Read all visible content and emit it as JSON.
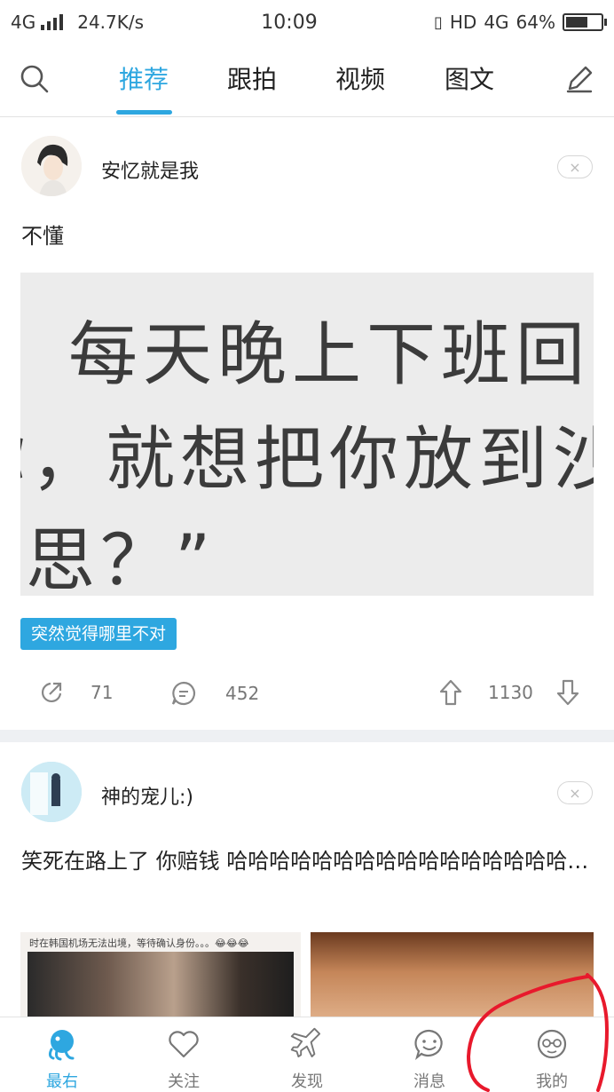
{
  "status_bar": {
    "network": "4G",
    "speed": "24.7K/s",
    "time": "10:09",
    "hd": "HD",
    "network2": "4G",
    "battery": "64%",
    "battery_level": 0.64
  },
  "top_nav": {
    "tabs": [
      {
        "label": "推荐",
        "active": true
      },
      {
        "label": "跟拍",
        "active": false
      },
      {
        "label": "视频",
        "active": false
      },
      {
        "label": "图文",
        "active": false
      }
    ]
  },
  "posts": [
    {
      "username": "安忆就是我",
      "close": "×",
      "text": "不懂",
      "image_lines": [
        "每天晚上下班回家",
        "你，就想把你放到沙",
        "思？”"
      ],
      "tag": "突然觉得哪里不对",
      "share_count": "71",
      "comment_count": "452",
      "up_count": "1130"
    },
    {
      "username": "神的宠儿:)",
      "close": "×",
      "text": "笑死在路上了 你赔钱 哈哈哈哈哈哈哈哈哈哈哈哈哈哈哈哈…",
      "image1_caption": "时在韩国机场无法出境，等待确认身份。。。😂😂😂"
    }
  ],
  "bottom_nav": {
    "items": [
      {
        "label": "最右",
        "active": true
      },
      {
        "label": "关注",
        "active": false
      },
      {
        "label": "发现",
        "active": false
      },
      {
        "label": "消息",
        "active": false
      },
      {
        "label": "我的",
        "active": false
      }
    ]
  },
  "colors": {
    "accent": "#2ea7e0",
    "annotation": "#e8192c"
  }
}
